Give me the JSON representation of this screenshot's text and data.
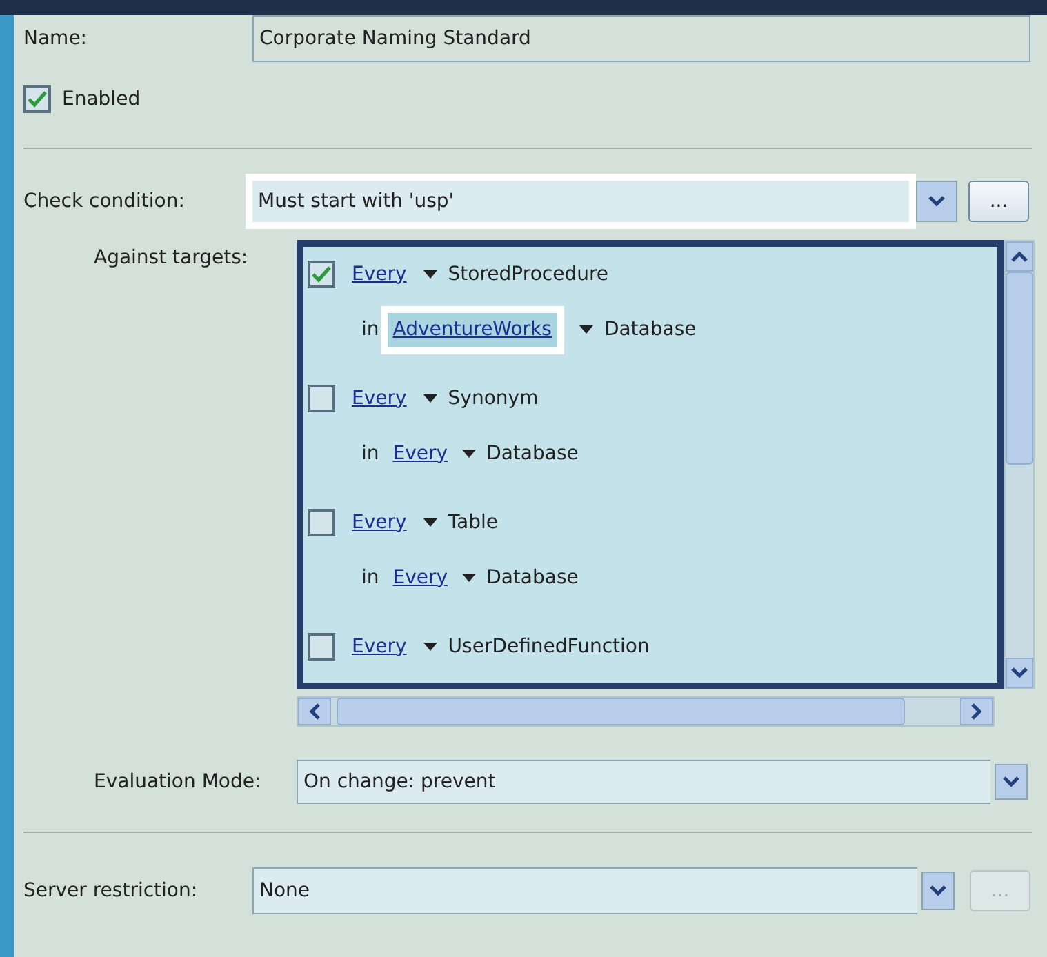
{
  "name": {
    "label": "Name:",
    "value": "Corporate Naming Standard"
  },
  "enabled": {
    "label": "Enabled",
    "checked": true
  },
  "check_condition": {
    "label": "Check condition:",
    "value": "Must start with 'usp'",
    "highlighted": true,
    "browse": "..."
  },
  "targets": {
    "label": "Against targets:",
    "highlighted": true,
    "items": [
      {
        "checked": true,
        "filter": "Every",
        "type": "StoredProcedure",
        "scope": {
          "prefix": "in",
          "filter": "AdventureWorks",
          "type": "Database",
          "highlighted": true
        }
      },
      {
        "checked": false,
        "filter": "Every",
        "type": "Synonym",
        "scope": {
          "prefix": "in",
          "filter": "Every",
          "type": "Database",
          "highlighted": false
        }
      },
      {
        "checked": false,
        "filter": "Every",
        "type": "Table",
        "scope": {
          "prefix": "in",
          "filter": "Every",
          "type": "Database",
          "highlighted": false
        }
      },
      {
        "checked": false,
        "filter": "Every",
        "type": "UserDefinedFunction"
      }
    ]
  },
  "evaluation_mode": {
    "label": "Evaluation Mode:",
    "value": "On change: prevent"
  },
  "server_restriction": {
    "label": "Server restriction:",
    "value": "None",
    "browse": "...",
    "browse_disabled": true
  }
}
